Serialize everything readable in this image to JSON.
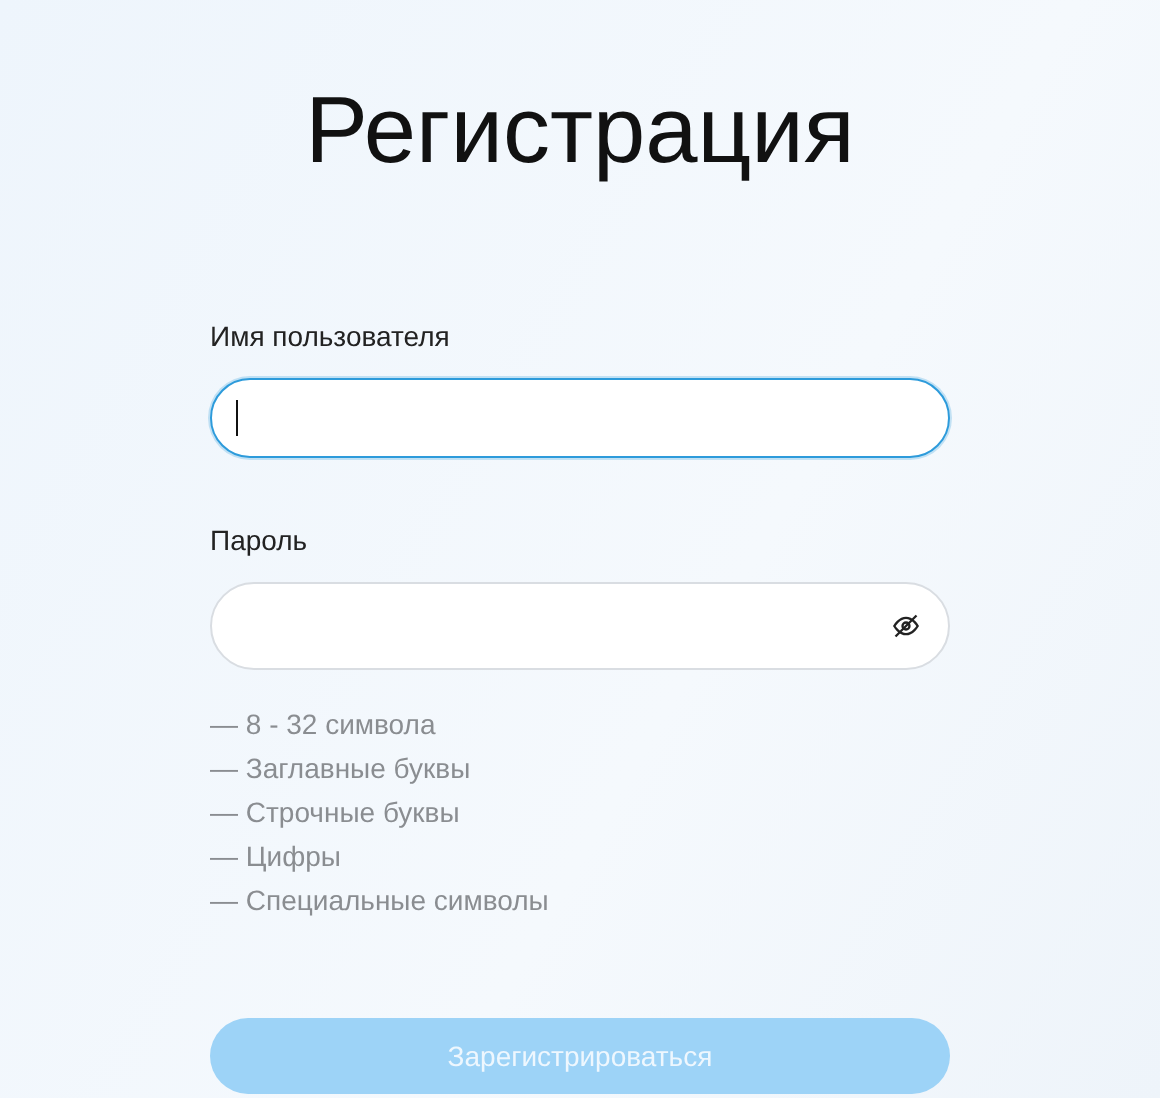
{
  "title": "Регистрация",
  "fields": [
    {
      "label": "Имя пользователя",
      "kind": "text",
      "focused": true
    },
    {
      "label": "Пароль",
      "kind": "password",
      "focused": false,
      "visible": false
    }
  ],
  "password_rules": [
    "— 8 - 32 символа",
    "— Заглавные буквы",
    "— Строчные буквы",
    "— Цифры",
    "— Специальные символы"
  ],
  "submit": {
    "label": "Зарегистрироваться",
    "disabled": true
  }
}
